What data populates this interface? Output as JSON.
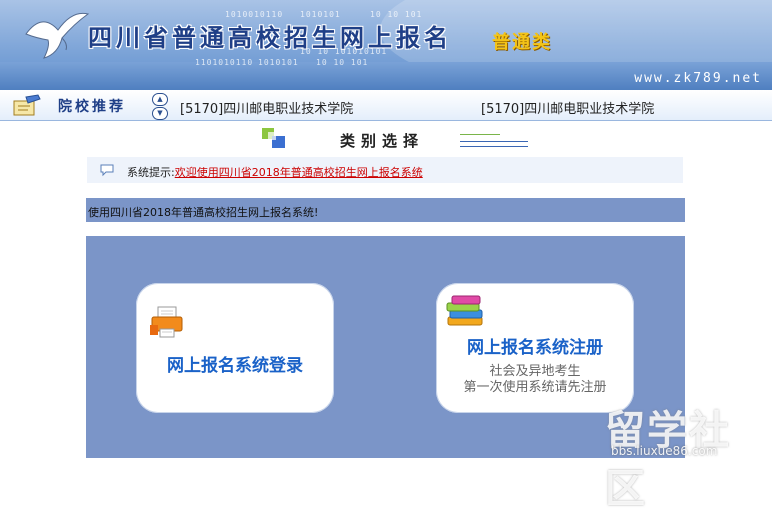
{
  "header": {
    "title": "四川省普通高校招生网上报名",
    "badge": "普通类",
    "url": "www.zk789.net",
    "binary_1": "1010010110",
    "binary_2": "1010101",
    "binary_3": "10 10 101",
    "binary_4": "1101010110",
    "binary_5": "1010101",
    "binary_6": "10 10 101",
    "binary_7": "10 10 101010101",
    "colors": {
      "title": "#1f3f87",
      "badge": "#f4c417",
      "banner": "#7ea5d8"
    }
  },
  "nav": {
    "label": "院校推荐",
    "up_arrow": "▲",
    "down_arrow": "▼",
    "schools": [
      "[5170]四川邮电职业技术学院",
      "[5170]四川邮电职业技术学院"
    ]
  },
  "category": {
    "title": "类别选择"
  },
  "tip": {
    "prefix": "系统提示:",
    "link_text": "欢迎使用四川省2018年普通高校招生网上报名系统"
  },
  "welcome": {
    "text": "使用四川省2018年普通高校招生网上报名系统!"
  },
  "cards": {
    "login": {
      "title": "网上报名系统登录"
    },
    "register": {
      "title": "网上报名系统注册",
      "sub_1": "社会及异地考生",
      "sub_2": "第一次使用系统请先注册"
    }
  },
  "watermark": {
    "big": "留学社区",
    "small": "bbs.liuxue86.com"
  }
}
